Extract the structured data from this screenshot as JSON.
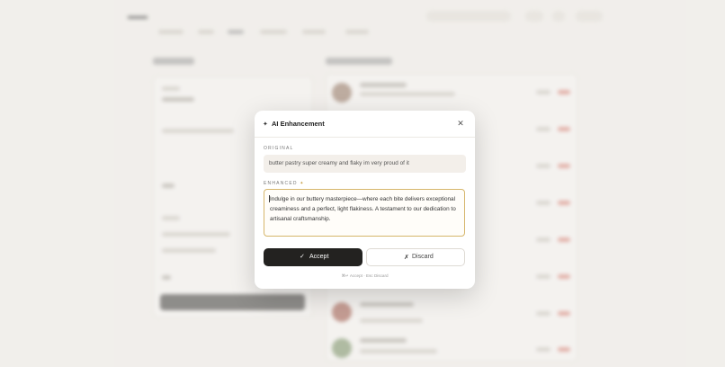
{
  "modal": {
    "sparkle_icon": "✦",
    "title": "AI Enhancement",
    "close_icon": "✕",
    "original_label": "ORIGINAL",
    "original_text": "butter pastry super creamy and flaky im very proud of it",
    "enhanced_label": "ENHANCED",
    "enhanced_star": "✦",
    "enhanced_text": "Indulge in our buttery masterpiece—where each bite delivers exceptional creaminess and a perfect, light flakiness. A testament to our dedication to artisanal craftsmanship.",
    "accept_icon": "✓",
    "accept_label": "Accept",
    "discard_icon": "✗",
    "discard_label": "Discard",
    "shortcut_hint": "⌘↵ Accept · Esc Discard"
  },
  "colors": {
    "accent_gold": "#d6b66b",
    "primary_dark": "#232220",
    "tag_red": "#d9776a"
  }
}
